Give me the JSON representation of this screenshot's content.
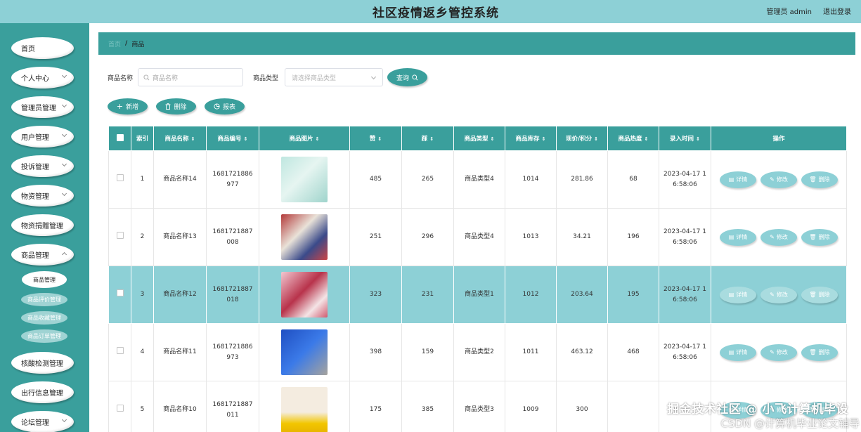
{
  "app": {
    "title": "社区疫情返乡管控系统",
    "user_label": "管理员 admin",
    "logout_label": "退出登录"
  },
  "sidebar": {
    "items": [
      {
        "label": "首页",
        "has_chevron": false
      },
      {
        "label": "个人中心",
        "has_chevron": true
      },
      {
        "label": "管理员管理",
        "has_chevron": true
      },
      {
        "label": "用户管理",
        "has_chevron": true
      },
      {
        "label": "投诉管理",
        "has_chevron": true
      },
      {
        "label": "物资管理",
        "has_chevron": true
      },
      {
        "label": "物资捐赠管理",
        "has_chevron": false
      },
      {
        "label": "商品管理",
        "has_chevron": true
      }
    ],
    "sub_items": [
      {
        "label": "商品管理",
        "active": true
      },
      {
        "label": "商品评价管理",
        "active": false
      },
      {
        "label": "商品收藏管理",
        "active": false
      },
      {
        "label": "商品订单管理",
        "active": false
      }
    ],
    "items_after": [
      {
        "label": "核酸检测管理",
        "has_chevron": false
      },
      {
        "label": "出行信息管理",
        "has_chevron": false
      },
      {
        "label": "论坛管理",
        "has_chevron": true
      }
    ]
  },
  "breadcrumb": {
    "home": "首页",
    "separator": "/",
    "current": "商品"
  },
  "search": {
    "name_label": "商品名称",
    "name_placeholder": "商品名称",
    "type_label": "商品类型",
    "type_placeholder": "请选择商品类型",
    "query_label": "查询"
  },
  "actions": {
    "add_label": "新增",
    "delete_label": "删除",
    "report_label": "报表"
  },
  "table": {
    "headers": [
      "索引",
      "商品名称",
      "商品编号",
      "商品图片",
      "赞",
      "踩",
      "商品类型",
      "商品库存",
      "现价/积分",
      "商品热度",
      "录入时间",
      "操作"
    ],
    "rows": [
      {
        "index": "1",
        "name": "商品名称14",
        "code": "1681721886977",
        "likes": "485",
        "dislikes": "265",
        "type": "商品类型4",
        "stock": "1014",
        "price": "281.86",
        "heat": "68",
        "time": "2023-04-17 16:58:06",
        "highlight": false
      },
      {
        "index": "2",
        "name": "商品名称13",
        "code": "1681721887008",
        "likes": "251",
        "dislikes": "296",
        "type": "商品类型4",
        "stock": "1013",
        "price": "34.21",
        "heat": "196",
        "time": "2023-04-17 16:58:06",
        "highlight": false
      },
      {
        "index": "3",
        "name": "商品名称12",
        "code": "1681721887018",
        "likes": "323",
        "dislikes": "231",
        "type": "商品类型1",
        "stock": "1012",
        "price": "203.64",
        "heat": "195",
        "time": "2023-04-17 16:58:06",
        "highlight": true
      },
      {
        "index": "4",
        "name": "商品名称11",
        "code": "1681721886973",
        "likes": "398",
        "dislikes": "159",
        "type": "商品类型2",
        "stock": "1011",
        "price": "463.12",
        "heat": "468",
        "time": "2023-04-17 16:58:06",
        "highlight": false
      },
      {
        "index": "5",
        "name": "商品名称10",
        "code": "1681721887011",
        "likes": "175",
        "dislikes": "385",
        "type": "商品类型3",
        "stock": "1009",
        "price": "300",
        "heat": "",
        "time": "",
        "highlight": false
      }
    ],
    "row_ops": {
      "detail_label": "详情",
      "edit_label": "修改",
      "delete_label": "删除"
    }
  },
  "watermark": {
    "line1": "掘金技术社区 @ 小飞计算机毕设",
    "line2": "CSDN @计算机毕业论文辅导"
  },
  "colors": {
    "primary": "#3a9f9c",
    "topbar": "#8dd0d6",
    "row_highlight": "#8dd0d6"
  }
}
